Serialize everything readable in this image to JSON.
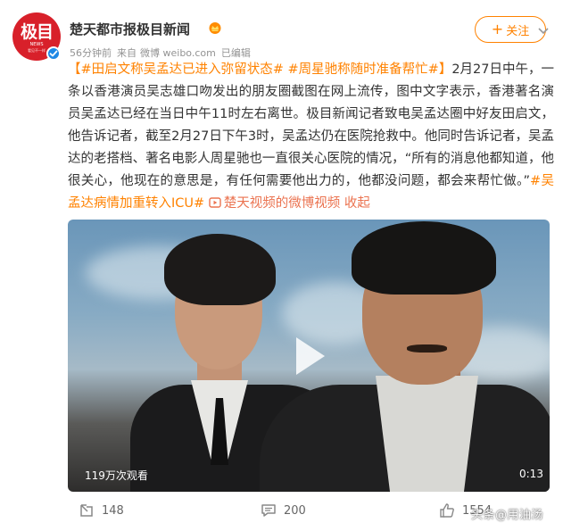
{
  "account": {
    "name": "楚天都市报极目新闻",
    "avatar_text": "极目",
    "avatar_sub": "NEWS",
    "avatar_sub2": "看见不一样",
    "time": "56分钟前",
    "source_label": "来自",
    "source": "微博 weibo.com",
    "edited": "已编辑"
  },
  "follow_button": {
    "label": "关注"
  },
  "post": {
    "bracket_open": "【",
    "tag1": "#田启文称吴孟达已进入弥留状态#",
    "tag2": "#周星驰称随时准备帮忙#",
    "bracket_close": "】",
    "body": "2月27日中午，一条以香港演员吴志雄口吻发出的朋友圈截图在网上流传，图中文字表示，香港著名演员吴孟达已经在当日中午11时左右离世。极目新闻记者致电吴孟达圈中好友田启文，他告诉记者，截至2月27日下午3时，吴孟达仍在医院抢救中。他同时告诉记者，吴孟达的老搭档、著名电影人周星驰也一直很关心医院的情况，“所有的消息他都知道，他很关心，他现在的意思是，有任何需要他出力的，他都没问题，都会来帮忙做。”",
    "tag3": "#吴孟达病情加重转入ICU#",
    "video_link": "楚天视频的微博视频",
    "collapse": "收起"
  },
  "video": {
    "views": "119万次观看",
    "duration": "0:13"
  },
  "actions": {
    "repost_count": "148",
    "comment_count": "200",
    "like_count": "1554"
  },
  "watermark": "头条@用油汤",
  "colors": {
    "accent_orange": "#ff8200",
    "link_orange": "#eb7350",
    "avatar_red": "#d8202a",
    "verified_blue": "#1e88e5"
  }
}
